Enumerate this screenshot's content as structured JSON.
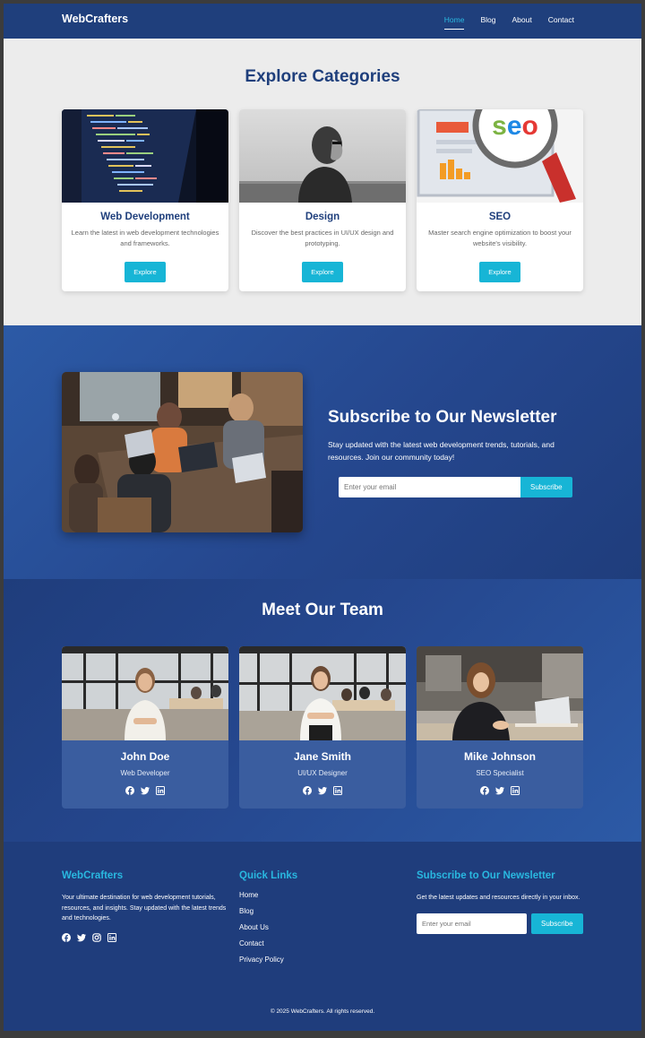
{
  "nav": {
    "brand": "WebCrafters",
    "links": [
      "Home",
      "Blog",
      "About",
      "Contact"
    ],
    "active": "Home"
  },
  "categories": {
    "title": "Explore Categories",
    "items": [
      {
        "title": "Web Development",
        "desc": "Learn the latest in web development technologies and frameworks.",
        "button": "Explore"
      },
      {
        "title": "Design",
        "desc": "Discover the best practices in UI/UX design and prototyping.",
        "button": "Explore"
      },
      {
        "title": "SEO",
        "desc": "Master search engine optimization to boost your website's visibility.",
        "button": "Explore"
      }
    ],
    "seo_image_text": "seo"
  },
  "newsletter": {
    "title": "Subscribe to Our Newsletter",
    "desc": "Stay updated with the latest web development trends, tutorials, and resources. Join our community today!",
    "placeholder": "Enter your email",
    "button": "Subscribe"
  },
  "team": {
    "title": "Meet Our Team",
    "members": [
      {
        "name": "John Doe",
        "role": "Web Developer"
      },
      {
        "name": "Jane Smith",
        "role": "UI/UX Designer"
      },
      {
        "name": "Mike Johnson",
        "role": "SEO Specialist"
      }
    ],
    "social_icons": [
      "facebook-icon",
      "twitter-icon",
      "linkedin-icon"
    ]
  },
  "footer": {
    "about": {
      "title": "WebCrafters",
      "text": "Your ultimate destination for web development tutorials, resources, and insights. Stay updated with the latest trends and technologies.",
      "social_icons": [
        "facebook-icon",
        "twitter-icon",
        "instagram-icon",
        "linkedin-icon"
      ]
    },
    "links": {
      "title": "Quick Links",
      "items": [
        "Home",
        "Blog",
        "About Us",
        "Contact",
        "Privacy Policy"
      ]
    },
    "newsletter": {
      "title": "Subscribe to Our Newsletter",
      "text": "Get the latest updates and resources directly in your inbox.",
      "placeholder": "Enter your email",
      "button": "Subscribe"
    },
    "copyright": "© 2025 WebCrafters. All rights reserved."
  },
  "colors": {
    "primary": "#1f3f7c",
    "accent": "#17b5d6",
    "link_accent": "#29b8e0",
    "background": "#ececec"
  }
}
